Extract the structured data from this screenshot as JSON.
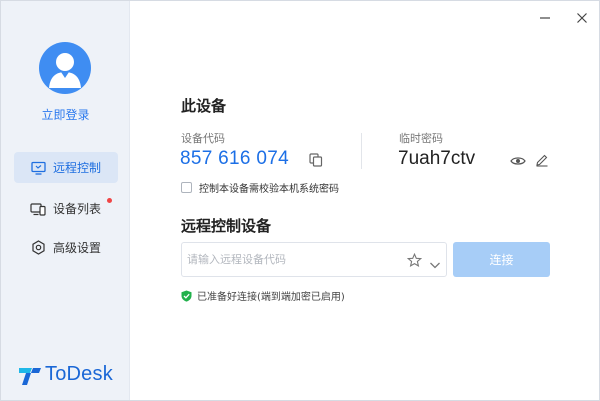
{
  "sidebar": {
    "login_label": "立即登录",
    "items": [
      {
        "label": "远程控制",
        "icon": "monitor-icon",
        "active": true
      },
      {
        "label": "设备列表",
        "icon": "devices-icon",
        "badge": true
      },
      {
        "label": "高级设置",
        "icon": "hexagon-settings-icon"
      }
    ],
    "brand": "ToDesk"
  },
  "colors": {
    "accent": "#1c6fe6",
    "sidebar_bg": "#eef2f8",
    "connect_disabled": "#a7cdf7",
    "status_green": "#22b14c",
    "badge_red": "#f04545"
  },
  "device": {
    "section_title": "此设备",
    "code_label": "设备代码",
    "code": "857 616 074",
    "password_label": "临时密码",
    "password": "7uah7ctv",
    "verify_label": "控制本设备需校验本机系统密码"
  },
  "remote": {
    "section_title": "远程控制设备",
    "input_placeholder": "请输入远程设备代码",
    "input_value": "",
    "connect_label": "连接",
    "status": "已准备好连接(端到端加密已启用)"
  }
}
